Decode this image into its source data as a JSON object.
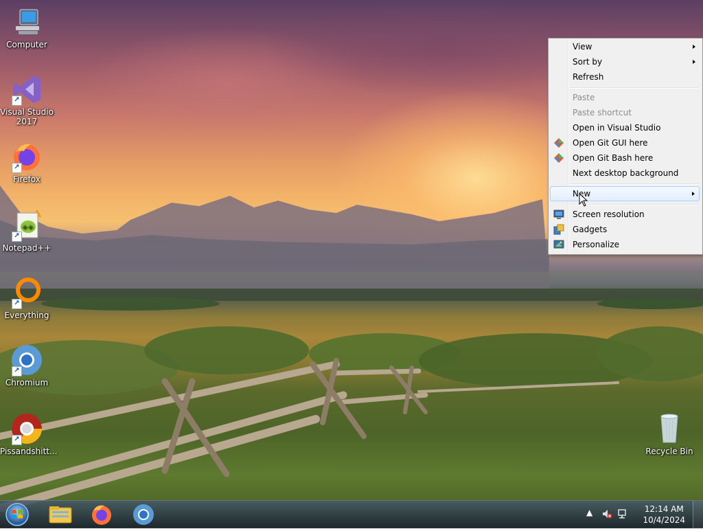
{
  "desktop": {
    "icons": [
      {
        "label": "Computer",
        "icon": "computer-icon"
      },
      {
        "label": "Visual Studio 2017",
        "line1": "Visual Studio",
        "line2": "2017",
        "icon": "visual-studio-icon"
      },
      {
        "label": "Firefox",
        "icon": "firefox-icon"
      },
      {
        "label": "Notepad++",
        "icon": "notepad-plus-plus-icon"
      },
      {
        "label": "Everything",
        "icon": "everything-search-icon"
      },
      {
        "label": "Chromium",
        "icon": "chromium-icon"
      },
      {
        "label": "Pissandshitt...",
        "icon": "chrome-variant-icon"
      },
      {
        "label": "Recycle Bin",
        "icon": "recycle-bin-icon"
      }
    ]
  },
  "context_menu": {
    "items": {
      "view": "View",
      "sort_by": "Sort by",
      "refresh": "Refresh",
      "paste": "Paste",
      "paste_shortcut": "Paste shortcut",
      "open_vs": "Open in Visual Studio",
      "open_git_gui": "Open Git GUI here",
      "open_git_bash": "Open Git Bash here",
      "next_bg": "Next desktop background",
      "new": "New",
      "screen_resolution": "Screen resolution",
      "gadgets": "Gadgets",
      "personalize": "Personalize"
    },
    "hovered": "New"
  },
  "taskbar": {
    "pinned": [
      "windows-explorer-icon",
      "firefox-icon",
      "chromium-icon"
    ],
    "clock": {
      "time": "12:14 AM",
      "date": "10/4/2024"
    }
  },
  "colors": {
    "menu_bg": "#f0f0f0",
    "menu_hover": "#e2eefc",
    "disabled_text": "#8d8d8d"
  }
}
